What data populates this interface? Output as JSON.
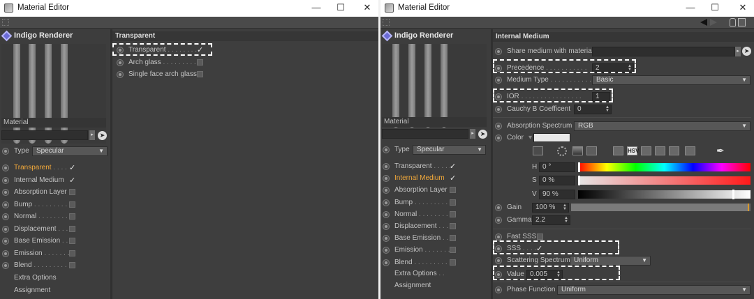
{
  "window1": {
    "title": "Material Editor",
    "renderer": "Indigo Renderer",
    "material_name": "Material",
    "type_label": "Type",
    "type_value": "Specular",
    "channels": [
      {
        "label": "Transparent",
        "dots": ". . . .",
        "checked": true,
        "highlight": true
      },
      {
        "label": "Internal Medium",
        "dots": "",
        "checked": true,
        "highlight": false
      },
      {
        "label": "Absorption Layer",
        "dots": "",
        "checked": false,
        "highlight": false
      },
      {
        "label": "Bump",
        "dots": ". . . . . . . . .",
        "checked": false,
        "highlight": false
      },
      {
        "label": "Normal",
        "dots": ". . . . . . . .",
        "checked": false,
        "highlight": false
      },
      {
        "label": "Displacement",
        "dots": ". . .",
        "checked": false,
        "highlight": false
      },
      {
        "label": "Base Emission",
        "dots": ". .",
        "checked": false,
        "highlight": false
      },
      {
        "label": "Emission",
        "dots": ". . . . . . .",
        "checked": false,
        "highlight": false
      },
      {
        "label": "Blend",
        "dots": ". . . . . . . . .",
        "checked": false,
        "highlight": false
      }
    ],
    "extra_options": "Extra Options",
    "assignment": "Assignment",
    "section_title": "Transparent",
    "options": [
      {
        "label": "Transparent",
        "dots": ". . . . . . . .",
        "checked": true
      },
      {
        "label": "Arch glass",
        "dots": ". . . . . . . . .",
        "checked": false
      },
      {
        "label": "Single face arch glass",
        "dots": "",
        "checked": false
      }
    ]
  },
  "window2": {
    "title": "Material Editor",
    "renderer": "Indigo Renderer",
    "material_name": "Material",
    "type_label": "Type",
    "type_value": "Specular",
    "channels": [
      {
        "label": "Transparent",
        "dots": ". . . . .",
        "checked": true,
        "highlight": false
      },
      {
        "label": "Internal Medium",
        "dots": "",
        "checked": true,
        "highlight": true
      },
      {
        "label": "Absorption Layer",
        "dots": "",
        "checked": false,
        "highlight": false
      },
      {
        "label": "Bump",
        "dots": ". . . . . . . . .",
        "checked": false,
        "highlight": false
      },
      {
        "label": "Normal",
        "dots": ". . . . . . . . .",
        "checked": false,
        "highlight": false
      },
      {
        "label": "Displacement",
        "dots": ". . .",
        "checked": false,
        "highlight": false
      },
      {
        "label": "Base Emission",
        "dots": ". .",
        "checked": false,
        "highlight": false
      },
      {
        "label": "Emission",
        "dots": ". . . . . . .",
        "checked": false,
        "highlight": false
      },
      {
        "label": "Blend",
        "dots": ". . . . . . . . .",
        "checked": false,
        "highlight": false
      }
    ],
    "extra_options": "Extra Options",
    "extra_dots": ". .",
    "assignment": "Assignment",
    "section_title": "Internal Medium",
    "share_medium_label": "Share medium with material",
    "precedence_label": "Precedence",
    "precedence_dots": ". . . . . . . . . . .",
    "precedence_value": "2",
    "medium_type_label": "Medium Type",
    "medium_type_dots": ". . . . . . . . . . .",
    "medium_type_value": "Basic",
    "ior_label": "IOR",
    "ior_dots": ". . . . . . . . . . . . . . . .",
    "ior_value": "1",
    "cauchy_label": "Cauchy B Coefficent",
    "cauchy_value": "0",
    "absorption_label": "Absorption Spectrum",
    "absorption_value": "RGB",
    "color_label": "Color",
    "color_swatch": "#e9e9e9",
    "color_mode": "HSV",
    "h_label": "H",
    "h_value": "0 °",
    "s_label": "S",
    "s_value": "0 %",
    "v_label": "V",
    "v_value": "90 %",
    "v_level": 0.9,
    "gain_label": "Gain",
    "gain_value": "100 %",
    "gain_level": 1.0,
    "gamma_label": "Gamma",
    "gamma_value": "2.2",
    "fast_sss_label": "Fast SSS",
    "sss_label": "SSS",
    "sss_dots": ". . . .",
    "scattering_label": "Scattering Spectrum",
    "scattering_value": "Uniform",
    "value_label": "Value",
    "value_value": "0.005",
    "phase_label": "Phase Function",
    "phase_value": "Uniform"
  },
  "colors": {
    "highlight": "#f2a93b",
    "dialog_bg": "#3e3e3e",
    "accent": "#6b6bd6"
  }
}
